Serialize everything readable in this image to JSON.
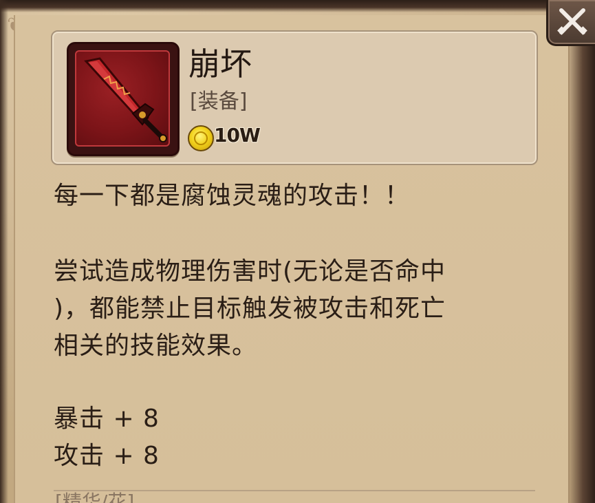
{
  "item": {
    "name": "崩坏",
    "type": "[装备]",
    "price": "10W",
    "icon": "sword-icon",
    "coin_icon": "gold-coin-icon"
  },
  "description": {
    "line1": "每一下都是腐蚀灵魂的攻击！！",
    "line2": "尝试造成物理伤害时(无论是否命中",
    "line3": ")，都能禁止目标触发被攻击和死亡",
    "line4": "相关的技能效果。"
  },
  "stats": [
    "暴击 + 8",
    "攻击 + 8"
  ],
  "footer": {
    "partial_label": "[精华/花]"
  },
  "controls": {
    "close_icon": "close-swords-icon"
  },
  "colors": {
    "parchment": "#d6bf9a",
    "icon_bg": "#7c1418",
    "coin": "#f2d21d"
  }
}
